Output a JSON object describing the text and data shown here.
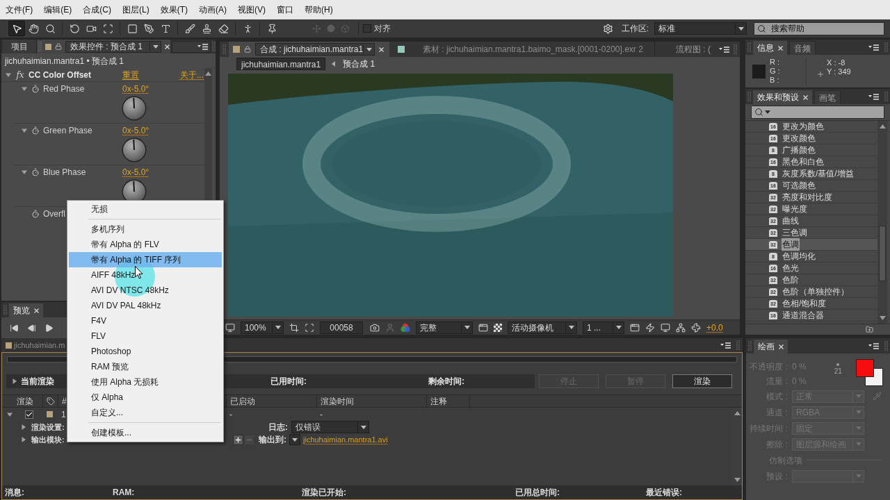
{
  "menu_bar": [
    "文件(F)",
    "编辑(E)",
    "合成(C)",
    "图层(L)",
    "效果(T)",
    "动画(A)",
    "视图(V)",
    "窗口",
    "帮助(H)"
  ],
  "toolbar": {
    "tools": [
      {
        "kind": "selection",
        "selected": true
      },
      {
        "kind": "hand",
        "selected": false
      },
      {
        "kind": "zoom",
        "selected": false
      },
      {
        "kind": "rotation",
        "selected": false
      },
      {
        "kind": "camera",
        "selected": false
      },
      {
        "kind": "pan",
        "selected": false
      },
      {
        "kind": "rectangle",
        "selected": false
      },
      {
        "kind": "pen",
        "selected": false
      },
      {
        "kind": "type",
        "selected": false
      },
      {
        "kind": "brush",
        "selected": false
      },
      {
        "kind": "stamp",
        "selected": false
      },
      {
        "kind": "eraser",
        "selected": false
      },
      {
        "kind": "roto",
        "selected": false
      },
      {
        "kind": "pin",
        "selected": false
      }
    ],
    "snap": {
      "label": "对齐",
      "checked": false
    },
    "workspace": {
      "label": "工作区:",
      "value": "标准"
    },
    "search": {
      "placeholder": "搜索帮助"
    }
  },
  "effect_controls": {
    "tabs": [
      {
        "label": "项目",
        "selected": false
      },
      {
        "label": "效果控件 : 预合成 1",
        "selected": true
      }
    ],
    "breadcrumb": "jichuhaimian.mantra1 • 预合成 1",
    "effect": {
      "switch": "fx",
      "name": "CC Color Offset",
      "expanded": true,
      "reset": "重置",
      "about": "关于..."
    },
    "properties": [
      {
        "kind": "angle",
        "name": "Red Phase",
        "value": "0x-5.0°",
        "expanded": true
      },
      {
        "kind": "angle",
        "name": "Green Phase",
        "value": "0x-5.0°",
        "expanded": true
      },
      {
        "kind": "angle",
        "name": "Blue Phase",
        "value": "0x-5.0°",
        "expanded": true
      },
      {
        "kind": "menu",
        "name": "Overfl"
      }
    ]
  },
  "preview": {
    "tabs": [
      {
        "label": "预览",
        "selected": true
      }
    ]
  },
  "composition": {
    "tabs": [
      {
        "label": "合成 : jichuhaimian.mantra1",
        "selected": true,
        "color": "#b7a37b"
      },
      {
        "label": "素材 : jichuhaimian.mantra1.baimo_mask.[0001-0200].exr 2",
        "selected": false,
        "color": "#93cabd"
      }
    ],
    "flowchart": "流程图 : (",
    "breadcrumb": [
      {
        "label": "jichuhaimian.mantra1",
        "selected": true
      },
      {
        "label": "预合成 1",
        "selected": false
      }
    ],
    "viewer_bar": {
      "zoom": "100%",
      "timecode": "00058",
      "resolution": "完整",
      "camera": "活动摄像机",
      "views": "1 ...",
      "exposure": "+0.0"
    }
  },
  "info": {
    "tabs": [
      {
        "label": "信息",
        "selected": true
      },
      {
        "label": "音频",
        "selected": false
      }
    ],
    "channels": [
      "R :",
      "G :",
      "B :"
    ],
    "position": [
      "X : -8",
      "Y : 349"
    ]
  },
  "effects_presets": {
    "tabs": [
      {
        "label": "效果和预设",
        "selected": true
      },
      {
        "label": "画笔",
        "selected": false
      }
    ],
    "items": [
      {
        "label": "更改为颜色",
        "depth": "16",
        "selected": false
      },
      {
        "label": "更改颜色",
        "depth": "16",
        "selected": false
      },
      {
        "label": "广播颜色",
        "depth": "8",
        "selected": false
      },
      {
        "label": "黑色和白色",
        "depth": "16",
        "selected": false
      },
      {
        "label": "灰度系数/基值/增益",
        "depth": "8",
        "selected": false
      },
      {
        "label": "可选颜色",
        "depth": "16",
        "selected": false
      },
      {
        "label": "亮度和对比度",
        "depth": "32",
        "selected": false
      },
      {
        "label": "曝光度",
        "depth": "32",
        "selected": false
      },
      {
        "label": "曲线",
        "depth": "32",
        "selected": false
      },
      {
        "label": "三色调",
        "depth": "32",
        "selected": false
      },
      {
        "label": "色调",
        "depth": "32",
        "selected": true
      },
      {
        "label": "色调均化",
        "depth": "8",
        "selected": false
      },
      {
        "label": "色光",
        "depth": "16",
        "selected": false
      },
      {
        "label": "色阶",
        "depth": "32",
        "selected": false
      },
      {
        "label": "色阶（单独控件）",
        "depth": "32",
        "selected": false
      },
      {
        "label": "色相/饱和度",
        "depth": "32",
        "selected": false
      },
      {
        "label": "通道混合器",
        "depth": "16",
        "selected": false
      }
    ]
  },
  "render_queue": {
    "tabs": [
      {
        "label": "jichuhaimian.m",
        "selected": false
      }
    ],
    "progress": {
      "level": 0
    },
    "current_render": {
      "label": "当前渲染",
      "expanded": false,
      "elapsed": "已用时间:",
      "remaining": "剩余时间:"
    },
    "buttons": [
      {
        "label": "停止",
        "disabled": true
      },
      {
        "label": "暂停",
        "disabled": true
      },
      {
        "label": "渲染",
        "disabled": false
      }
    ],
    "columns": [
      "渲染",
      "#",
      "已启动",
      "渲染时间",
      "注释"
    ],
    "items": [
      {
        "expanded": true,
        "checked": true,
        "number": "1",
        "started": "-",
        "render_time": "-",
        "settings": [
          {
            "kind": "log",
            "label": "渲染设置:",
            "expanded": false,
            "field_label": "日志:",
            "value": "仅错误"
          },
          {
            "kind": "output",
            "label": "输出模块:",
            "expanded": false,
            "field_label": "输出到:",
            "value": "jichuhaimian.mantra1.avi"
          }
        ]
      }
    ],
    "status": [
      "消息:",
      "RAM:",
      "渲染已开始:",
      "已用总时间:",
      "最近错误:"
    ]
  },
  "paint": {
    "tabs": [
      {
        "label": "绘画",
        "selected": true
      }
    ],
    "disabled": true,
    "brush_size": "21",
    "swatches": [
      {
        "color": "#f50d0d"
      },
      {
        "color": "#f2f2f2"
      }
    ],
    "fields": [
      {
        "kind": "value",
        "label": "不透明度 :",
        "value": "0 %"
      },
      {
        "kind": "value",
        "label": "流量 :",
        "value": "0 %"
      },
      {
        "kind": "dropdown",
        "label": "模式 :",
        "value": "正常"
      },
      {
        "kind": "dropdown",
        "label": "通道 :",
        "value": "RGBA"
      },
      {
        "kind": "dropdown",
        "label": "持续时间 :",
        "value": "固定"
      },
      {
        "kind": "dropdown",
        "label": "擦除 :",
        "value": "图层源和绘画"
      },
      {
        "kind": "section",
        "label": "仿制选项"
      },
      {
        "kind": "dropdown",
        "label": "预设 :"
      }
    ]
  },
  "context_menu": {
    "items": [
      {
        "kind": "item",
        "label": "无损",
        "selected": false
      },
      {
        "kind": "separator"
      },
      {
        "kind": "item",
        "label": "多机序列",
        "selected": false
      },
      {
        "kind": "item",
        "label": "带有 Alpha 的 FLV",
        "selected": false
      },
      {
        "kind": "item",
        "label": "带有 Alpha 的 TIFF 序列",
        "selected": true
      },
      {
        "kind": "item",
        "label": "AIFF 48kHz",
        "selected": false
      },
      {
        "kind": "item",
        "label": "AVI DV NTSC 48kHz",
        "selected": false
      },
      {
        "kind": "item",
        "label": "AVI DV PAL 48kHz",
        "selected": false
      },
      {
        "kind": "item",
        "label": "F4V",
        "selected": false
      },
      {
        "kind": "item",
        "label": "FLV",
        "selected": false
      },
      {
        "kind": "item",
        "label": "Photoshop",
        "selected": false
      },
      {
        "kind": "item",
        "label": "RAM 预览",
        "selected": false
      },
      {
        "kind": "item",
        "label": "使用 Alpha 无损耗",
        "selected": false
      },
      {
        "kind": "item",
        "label": "仅 Alpha",
        "selected": false
      },
      {
        "kind": "item",
        "label": "自定义...",
        "selected": false
      },
      {
        "kind": "separator"
      },
      {
        "kind": "item",
        "label": "创建模板...",
        "selected": false
      }
    ]
  }
}
